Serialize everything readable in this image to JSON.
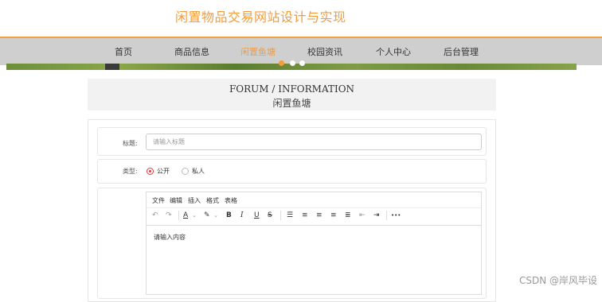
{
  "site": {
    "title": "闲置物品交易网站设计与实现"
  },
  "nav": {
    "items": [
      {
        "label": "首页"
      },
      {
        "label": "商品信息"
      },
      {
        "label": "闲置鱼塘",
        "active": true
      },
      {
        "label": "校园资讯"
      },
      {
        "label": "个人中心"
      },
      {
        "label": "后台管理"
      }
    ]
  },
  "heading": {
    "en": "FORUM / INFORMATION",
    "cn": "闲置鱼塘"
  },
  "form": {
    "title_label": "标题:",
    "title_placeholder": "请输入标题",
    "title_value": "",
    "type_label": "类型:",
    "type_options": [
      {
        "label": "公开",
        "checked": true
      },
      {
        "label": "私人",
        "checked": false
      }
    ]
  },
  "editor": {
    "menu": [
      "文件",
      "编辑",
      "插入",
      "格式",
      "表格"
    ],
    "toolbar": {
      "undo": "↶",
      "redo": "↷",
      "font_color": "A",
      "highlight": "✎",
      "bold": "B",
      "italic": "I",
      "underline": "U",
      "strike": "S",
      "bullets": "☰",
      "align_left": "≡",
      "align_center": "≡",
      "align_right": "≡",
      "justify": "≣",
      "outdent": "⇤",
      "indent": "⇥",
      "more": "•••"
    },
    "placeholder": "请输入内容"
  },
  "watermark": "CSDN @岸风毕设",
  "colors": {
    "accent": "#f39c3c",
    "radio_checked": "#e0393e",
    "nav_bg": "#cfcfcf"
  }
}
